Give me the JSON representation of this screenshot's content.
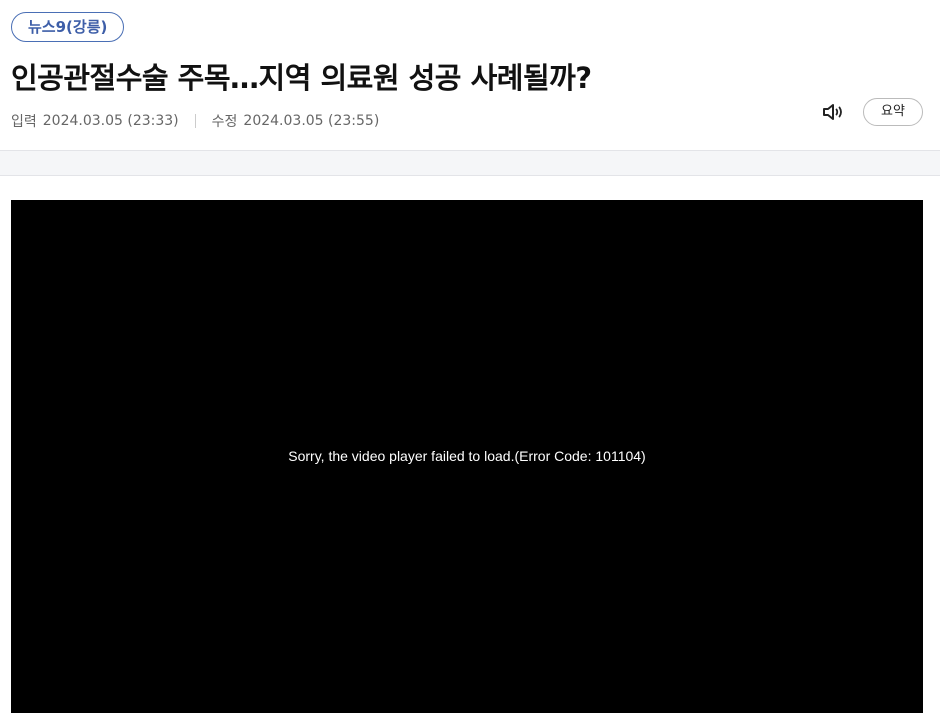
{
  "article": {
    "category": "뉴스9(강릉)",
    "headline": "인공관절수술 주목…지역 의료원 성공 사례될까?",
    "meta": {
      "published_label": "입력",
      "published_value": "2024.03.05 (23:33)",
      "modified_label": "수정",
      "modified_value": "2024.03.05 (23:55)"
    },
    "actions": {
      "speaker_icon": "speaker-icon",
      "summary_label": "요약"
    }
  },
  "video": {
    "error_message": "Sorry, the video player failed to load.(Error Code: 101104)"
  },
  "colors": {
    "accent": "#3d5ea8",
    "video_bg": "#000000",
    "band_bg": "#f5f6f8"
  }
}
